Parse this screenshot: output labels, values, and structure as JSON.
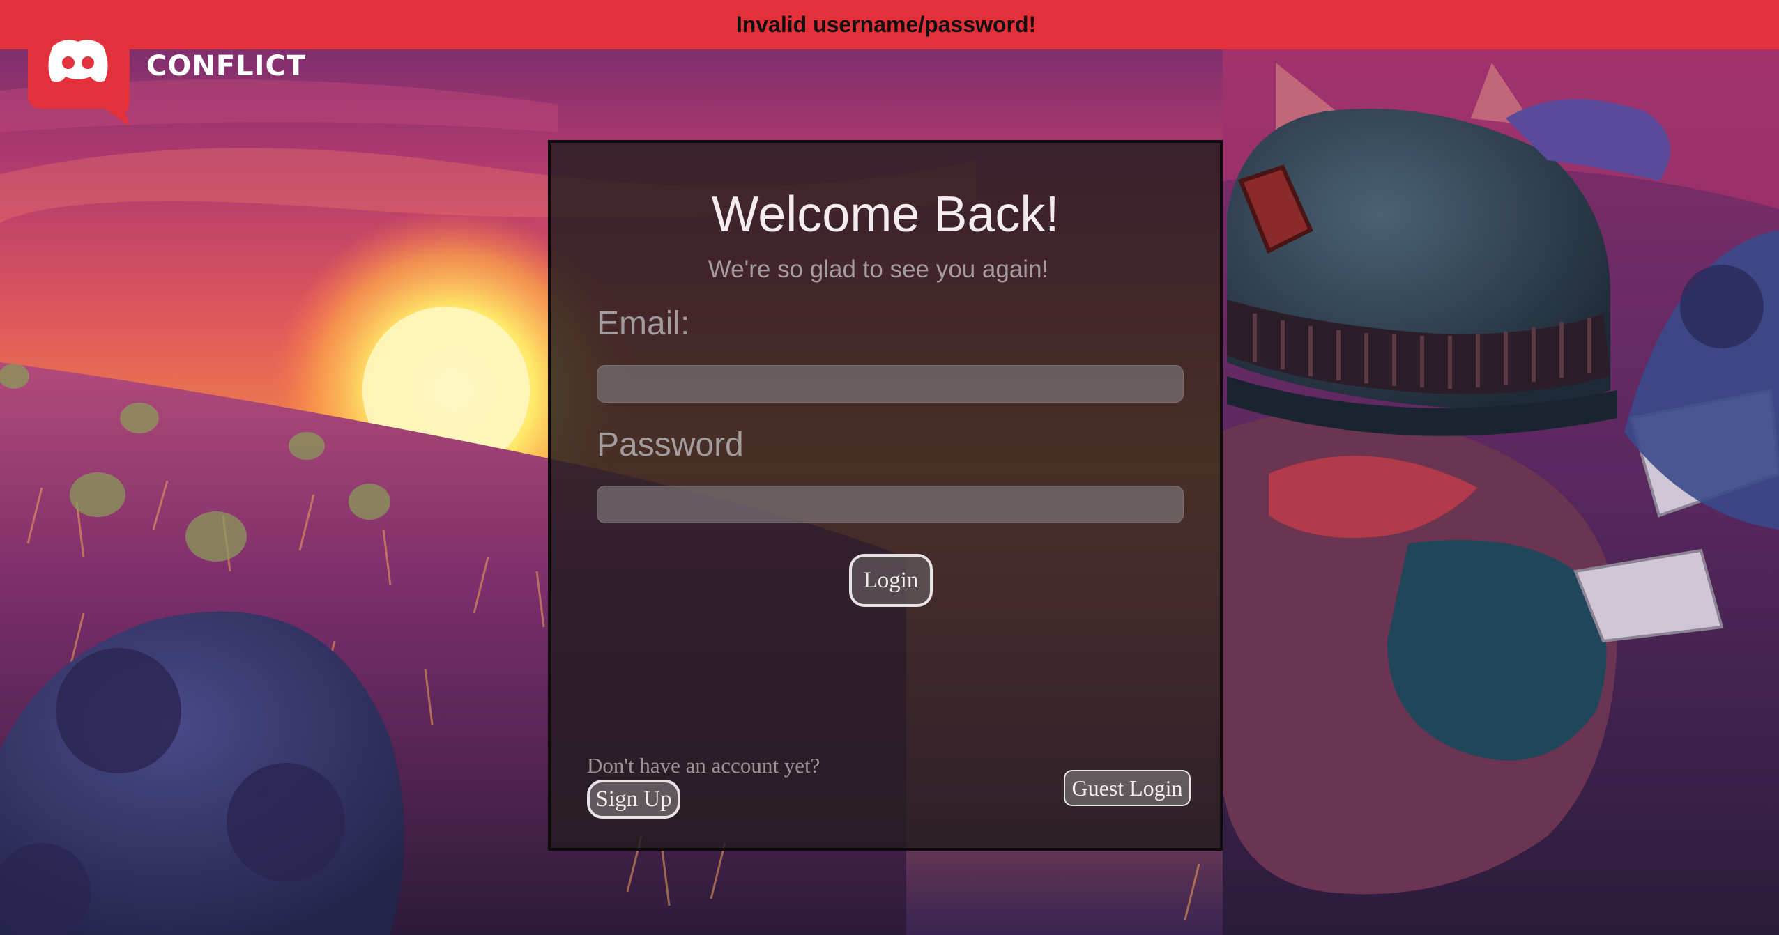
{
  "banner": {
    "message": "Invalid username/password!",
    "color": "#e3313b"
  },
  "brand": {
    "name": "CONFLICT",
    "logo_icon": "game-controller-chat-bubble-icon",
    "logo_color": "#e3313b"
  },
  "login_card": {
    "title": "Welcome Back!",
    "subtitle": "We're so glad to see you again!",
    "email_label": "Email:",
    "email_value": "",
    "password_label": "Password",
    "password_value": "",
    "login_label": "Login",
    "signup_prompt": "Don't have an account yet?",
    "signup_label": "Sign Up",
    "guest_label": "Guest Login"
  }
}
